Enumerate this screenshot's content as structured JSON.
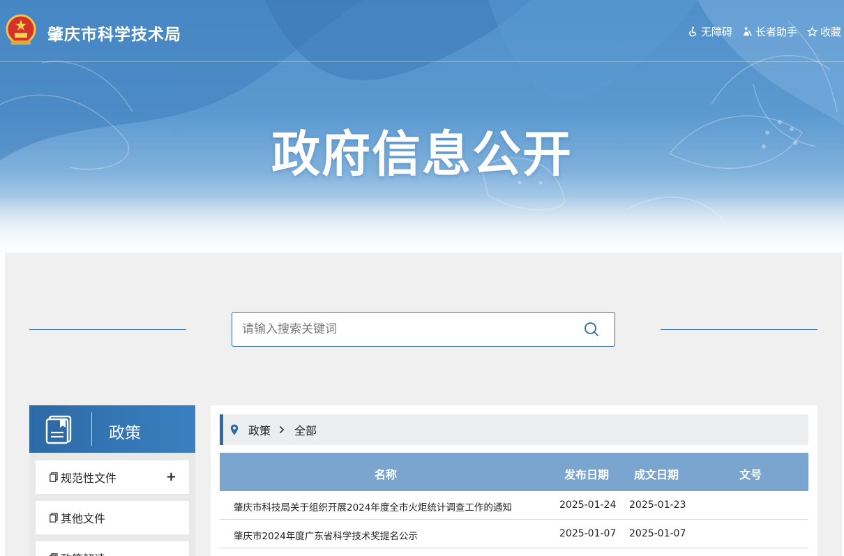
{
  "header": {
    "site_title": "肇庆市科学技术局",
    "links": [
      {
        "label": "无障碍",
        "icon": "wheelchair-icon"
      },
      {
        "label": "长者助手",
        "icon": "elder-helper-icon"
      },
      {
        "label": "收藏",
        "icon": "star-icon"
      }
    ],
    "hero_title": "政府信息公开"
  },
  "search": {
    "placeholder": "请输入搜索关键词",
    "icon": "search-icon"
  },
  "sidebar": {
    "title": "政策",
    "items": [
      {
        "label": "规范性文件",
        "expand": "+"
      },
      {
        "label": "其他文件"
      },
      {
        "label": "政策解读"
      }
    ]
  },
  "breadcrumb": {
    "items": [
      "政策",
      "全部"
    ]
  },
  "table": {
    "columns": [
      "名称",
      "发布日期",
      "成文日期",
      "文号"
    ],
    "rows": [
      {
        "name": "肇庆市科技局关于组织开展2024年度全市火炬统计调查工作的通知",
        "published": "2025-01-24",
        "written": "2025-01-23",
        "doc_no": ""
      },
      {
        "name": "肇庆市2024年度广东省科学技术奖提名公示",
        "published": "2025-01-07",
        "written": "2025-01-07",
        "doc_no": ""
      }
    ]
  },
  "colors": {
    "primary": "#2d6aa6",
    "table_header": "#7aa5cf",
    "panel_bg": "#f0f0f0"
  }
}
